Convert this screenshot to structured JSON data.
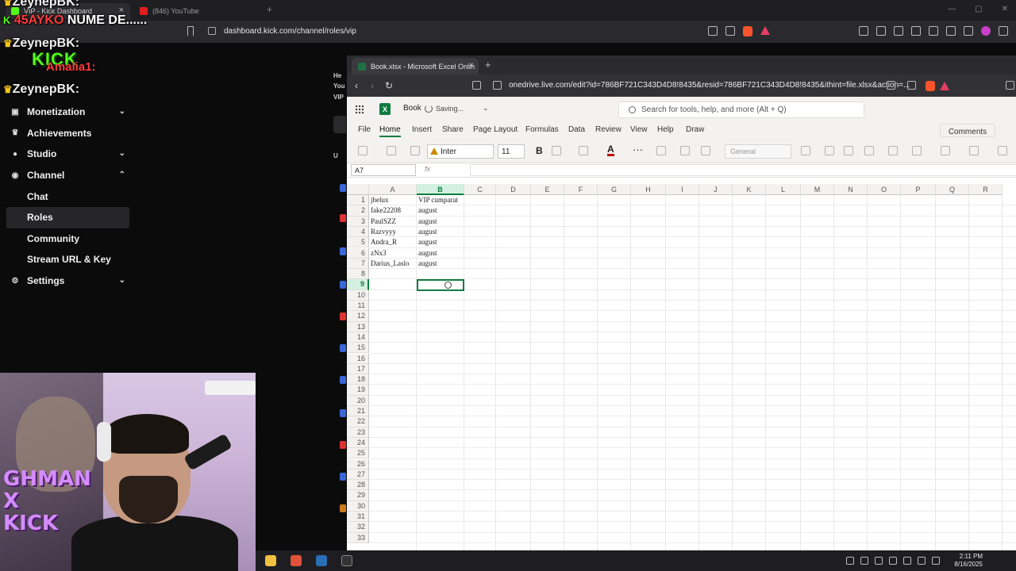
{
  "browser": {
    "tab_kick": "VIP - Kick Dashboard",
    "tab_youtube": "(846) YouTube",
    "url": "dashboard.kick.com/channel/roles/vip"
  },
  "chat": {
    "line1_user": "ZeynepBK:",
    "line2_user": "45AYKO",
    "line2_msg": "NUME DE......",
    "line3_user": "ZeynepBK:",
    "line4_user": "Amalia1:",
    "line5_user": "ZeynepBK:",
    "kick_logo": "KICK"
  },
  "sidebar": {
    "items": [
      {
        "label": "Monetization",
        "icon": "dollar-icon",
        "expandable": true
      },
      {
        "label": "Achievements",
        "icon": "trophy-icon",
        "expandable": false
      },
      {
        "label": "Studio",
        "icon": "camera-icon",
        "expandable": true
      },
      {
        "label": "Channel",
        "icon": "broadcast-icon",
        "expandable": true,
        "expanded": true
      },
      {
        "label": "Chat",
        "sub": true
      },
      {
        "label": "Roles",
        "sub": true,
        "active": true
      },
      {
        "label": "Community",
        "sub": true
      },
      {
        "label": "Stream URL & Key",
        "sub": true
      },
      {
        "label": "Settings",
        "icon": "gear-icon",
        "expandable": true
      }
    ]
  },
  "kick_mid": {
    "t1": "He",
    "t2": "You",
    "t3": "VIP",
    "col_header": "U"
  },
  "excel_window": {
    "tab_title": "Book.xlsx - Microsoft Excel Onlin",
    "url": "onedrive.live.com/edit?id=786BF721C343D4D8!8435&resid=786BF721C343D4D8!8435&ithint=file.xlsx&action=..."
  },
  "excel": {
    "book_name": "Book",
    "status": "Saving...",
    "search_placeholder": "Search for tools, help, and more (Alt + Q)",
    "menu": [
      "File",
      "Home",
      "Insert",
      "Share",
      "Page Layout",
      "Formulas",
      "Data",
      "Review",
      "View",
      "Help",
      "Draw"
    ],
    "comments_label": "Comments",
    "font_name": "Inter",
    "font_size": "11",
    "bold_label": "B",
    "font_color_label": "A",
    "more_label": "···",
    "number_format": "General",
    "name_box": "A7",
    "fx_label": "fx",
    "columns": [
      "A",
      "B",
      "C",
      "D",
      "E",
      "F",
      "G",
      "H",
      "I",
      "J",
      "K",
      "L",
      "M",
      "N",
      "O",
      "P",
      "Q",
      "R"
    ],
    "selected_column": "B",
    "selected_row": 9,
    "row_count": 34,
    "cells": [
      [
        "jbelux",
        "VIP cumparat"
      ],
      [
        "fake22208",
        "august"
      ],
      [
        "PaulSZZ",
        "august"
      ],
      [
        "Razvyyy",
        "august"
      ],
      [
        "Andra_R",
        "august"
      ],
      [
        "zNx3",
        "august"
      ],
      [
        "Darius_Laslo",
        "august"
      ]
    ]
  },
  "cam": {
    "overlay_text": "GHMAN\nX\nKICK"
  },
  "taskbar": {
    "time": "2:11 PM",
    "date": "8/16/2025"
  },
  "colors": {
    "kick_green": "#53fc18",
    "excel_green": "#107c41",
    "chat_red": "#ff3b3b"
  }
}
